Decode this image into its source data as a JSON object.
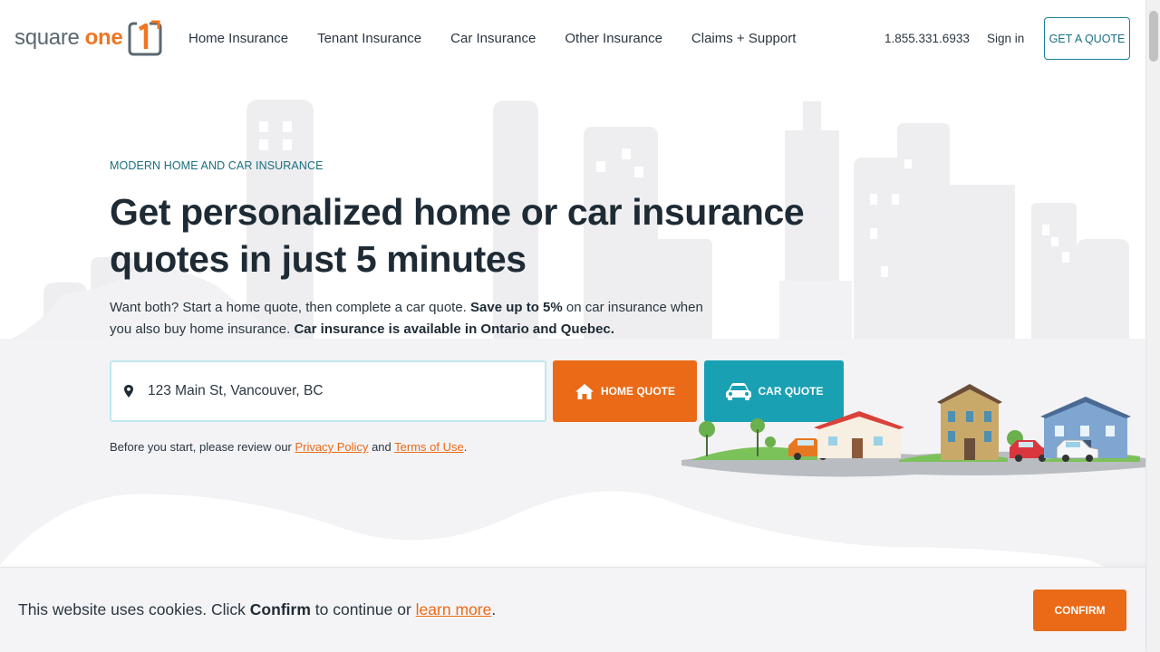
{
  "brand": {
    "logo_text_light": "square",
    "logo_text_bold": "one",
    "logo_mark": "1"
  },
  "nav": {
    "items": [
      {
        "label": "Home Insurance"
      },
      {
        "label": "Tenant Insurance"
      },
      {
        "label": "Car Insurance"
      },
      {
        "label": "Other Insurance"
      },
      {
        "label": "Claims + Support"
      }
    ],
    "phone": "1.855.331.6933",
    "signin_label": "Sign in",
    "quote_label": "GET A QUOTE"
  },
  "hero": {
    "eyebrow": "MODERN HOME AND CAR INSURANCE",
    "headline": "Get personalized home or car insurance quotes in just 5 minutes",
    "sub_1": "Want both? Start a home quote, then complete a car quote.",
    "sub_2": "Save up to 5%",
    "sub_3": "on car insurance when you also buy home insurance.",
    "sub_4": "Car insurance is available in Ontario and Quebec.",
    "address_value": "123 Main St, Vancouver, BC",
    "home_quote_label": "HOME QUOTE",
    "car_quote_label": "CAR QUOTE",
    "legal_prefix": "Before you start, please review our",
    "privacy_label": "Privacy Policy",
    "legal_and": "and",
    "terms_label": "Terms of Use",
    "legal_suffix": "."
  },
  "cookie": {
    "text_1": "This website uses cookies. Click",
    "text_bold": "Confirm",
    "text_2": "to continue or",
    "learn_more": "learn more",
    "text_end": ".",
    "confirm_label": "CONFIRM"
  },
  "colors": {
    "brand_orange": "#ea6a17",
    "brand_teal": "#1aa0b3",
    "dark_text": "#1e2b35"
  },
  "icons": [
    "location-pin-icon",
    "house-icon",
    "car-icon"
  ]
}
